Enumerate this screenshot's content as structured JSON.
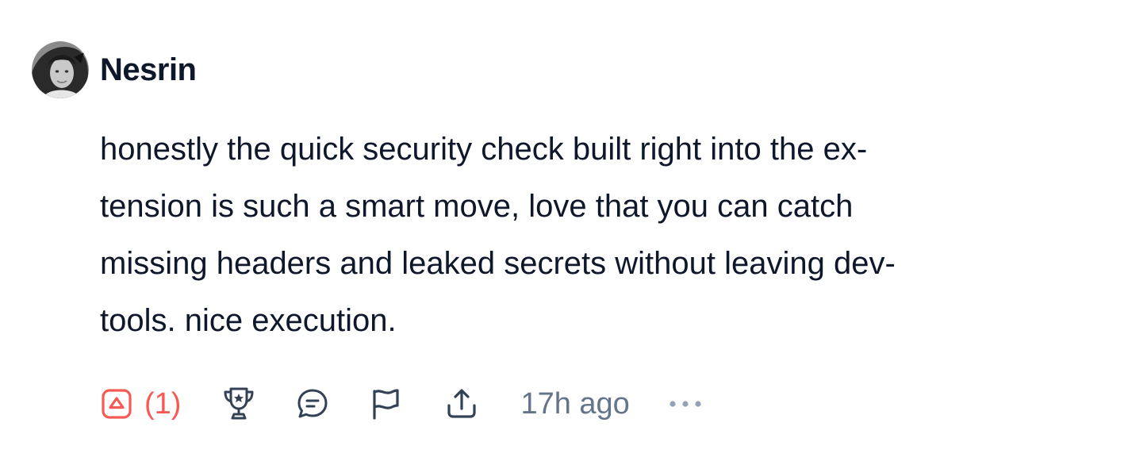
{
  "comment": {
    "author": "Nesrin",
    "body_lines": [
      "honestly the quick security check built right into the ex-",
      "tension is such a smart move, love that you can catch",
      "missing headers and leaked secrets without leaving dev-",
      "tools. nice execution."
    ],
    "upvote_count": "(1)",
    "timestamp": "17h ago"
  },
  "icons": {
    "upvote": "upvote-icon",
    "award": "trophy-icon",
    "reply": "reply-icon",
    "report": "flag-icon",
    "share": "share-icon",
    "more": "more-icon"
  },
  "colors": {
    "text": "#0f172a",
    "upvote_accent": "#f45b55",
    "muted": "#64748b",
    "icon": "#334155",
    "more_dots": "#94a3b8"
  }
}
